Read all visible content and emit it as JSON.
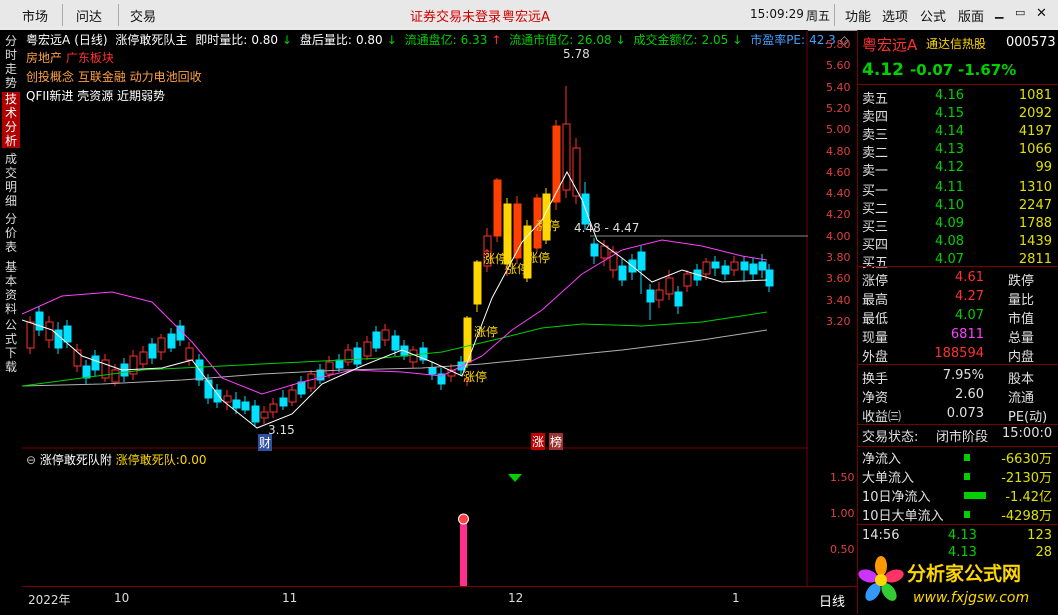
{
  "menubar": {
    "left_items": [
      "市场",
      "问达",
      "交易"
    ],
    "notice": "证券交易未登录",
    "stock_tab": "粤宏远A",
    "time": "15:09:29",
    "weekday": "周五",
    "right_items": [
      "功能",
      "选项",
      "公式",
      "版面"
    ]
  },
  "left_tabs": [
    "分时走势",
    "技术分析",
    "成交明细",
    "分价表",
    "基本资料",
    "公式下载"
  ],
  "left_tab_active": 1,
  "info_bar": {
    "title": "粤宏远A",
    "period": "(日线)",
    "indicator": "涨停敢死队主",
    "items": [
      {
        "label": "即时量比:",
        "value": "0.80",
        "arrow": "↓"
      },
      {
        "label": "盘后量比:",
        "value": "0.80",
        "arrow": "↓"
      },
      {
        "label": "流通盘亿:",
        "value": "6.33",
        "arrow": "↑"
      },
      {
        "label": "流通市值亿:",
        "value": "26.08",
        "arrow": "↓"
      },
      {
        "label": "成交金额亿:",
        "value": "2.05",
        "arrow": "↓"
      },
      {
        "label": "市盈率PE:",
        "value": "42.3",
        "arrow": "◇"
      }
    ]
  },
  "concepts": {
    "line1_a": "房地产",
    "line1_b": "广东板块",
    "line2": "创投概念 互联金融 动力电池回收",
    "line3": "QFII新进 壳资源 近期弱势"
  },
  "annotations": {
    "high": "5.78",
    "low": "3.15",
    "range": "4.48 - 4.47",
    "zt": "涨停",
    "cai": "财",
    "zhang": "涨",
    "bang": "榜"
  },
  "price_axis": [
    "5.80",
    "5.60",
    "5.40",
    "5.20",
    "5.00",
    "4.80",
    "4.60",
    "4.40",
    "4.20",
    "4.00",
    "3.80",
    "3.60",
    "3.40",
    "3.20"
  ],
  "sub_axis": [
    "1.50",
    "1.00",
    "0.50"
  ],
  "sub_info": {
    "title": "涨停敢死队附",
    "label": "涨停敢死队:",
    "value": "0.00"
  },
  "bottom_axis": {
    "labels": [
      "2022年",
      "10",
      "11",
      "12",
      "1"
    ],
    "period_button": "日线"
  },
  "stock": {
    "name": "粤宏远A",
    "tag": "通达信热股",
    "code": "000573",
    "price": "4.12",
    "change": "-0.07",
    "pct": "-1.67%"
  },
  "order_book": {
    "asks": [
      {
        "label": "卖五",
        "price": "4.16",
        "volume": "1081"
      },
      {
        "label": "卖四",
        "price": "4.15",
        "volume": "2092"
      },
      {
        "label": "卖三",
        "price": "4.14",
        "volume": "4197"
      },
      {
        "label": "卖二",
        "price": "4.13",
        "volume": "1066"
      },
      {
        "label": "卖一",
        "price": "4.12",
        "volume": "99"
      }
    ],
    "bids": [
      {
        "label": "买一",
        "price": "4.11",
        "volume": "1310"
      },
      {
        "label": "买二",
        "price": "4.10",
        "volume": "2247"
      },
      {
        "label": "买三",
        "price": "4.09",
        "volume": "1788"
      },
      {
        "label": "买四",
        "price": "4.08",
        "volume": "1439"
      },
      {
        "label": "买五",
        "price": "4.07",
        "volume": "2811"
      }
    ]
  },
  "quote": [
    {
      "l1": "涨停",
      "v1": "4.61",
      "l2": "跌停"
    },
    {
      "l1": "最高",
      "v1": "4.27",
      "l2": "量比"
    },
    {
      "l1": "最低",
      "v1": "4.07",
      "l2": "市值"
    },
    {
      "l1": "现量",
      "v1": "6811",
      "l2": "总量"
    },
    {
      "l1": "外盘",
      "v1": "188594",
      "l2": "内盘"
    }
  ],
  "ratios": [
    {
      "l": "换手",
      "v": "7.95%",
      "l2": "股本"
    },
    {
      "l": "净资",
      "v": "2.60",
      "l2": "流通"
    },
    {
      "l": "收益㈢",
      "v": "0.073",
      "l2": "PE(动)"
    }
  ],
  "status": {
    "label": "交易状态:",
    "value": "闭市阶段",
    "time": "15:00:0"
  },
  "flows": [
    {
      "label": "净流入",
      "value": "-6630万"
    },
    {
      "label": "大单流入",
      "value": "-2130万"
    },
    {
      "label": "10日净流入",
      "value": "-1.42亿"
    },
    {
      "label": "10日大单流入",
      "value": "-4298万"
    }
  ],
  "ticks": [
    {
      "time": "14:56",
      "price": "4.13",
      "vol": "123"
    },
    {
      "time": "",
      "price": "4.13",
      "vol": "28"
    }
  ],
  "watermark": {
    "text": "分析家公式网",
    "url": "www.fxjgsw.com"
  },
  "colors": {
    "up": "#ff3030",
    "down": "#00ffff",
    "zt_bar": "#ffd700",
    "ma5": "#ffffff",
    "ma10": "#ff40ff",
    "ma20": "#00d000",
    "ma60": "#aaaaaa"
  }
}
